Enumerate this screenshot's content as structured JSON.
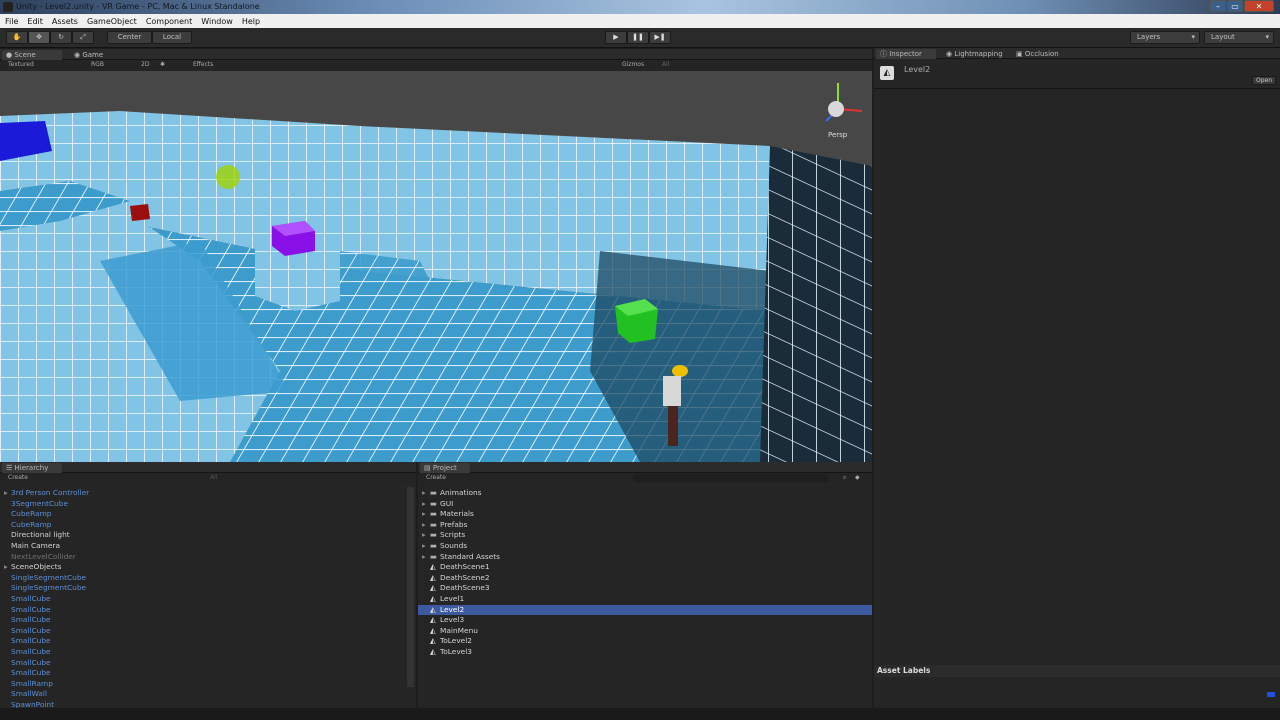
{
  "window": {
    "title": "Unity - Level2.unity - VR Game - PC, Mac & Linux Standalone"
  },
  "menu": [
    "File",
    "Edit",
    "Assets",
    "GameObject",
    "Component",
    "Window",
    "Help"
  ],
  "toolbar": {
    "pivot": "Center",
    "space": "Local",
    "layers": "Layers",
    "layout": "Layout"
  },
  "scene": {
    "tab_scene": "Scene",
    "tab_game": "Game",
    "shading": "Textured",
    "render": "RGB",
    "mode2d": "2D",
    "effects": "Effects",
    "gizmos": "Gizmos",
    "search": "All",
    "persp": "Persp"
  },
  "hierarchy": {
    "title": "Hierarchy",
    "create": "Create",
    "search": "All",
    "items": [
      {
        "label": "3rd Person Controller",
        "color": "blue",
        "fold": true
      },
      {
        "label": "3SegmentCube",
        "color": "blue",
        "fold": false
      },
      {
        "label": "CubeRamp",
        "color": "blue",
        "fold": false
      },
      {
        "label": "CubeRamp",
        "color": "blue",
        "fold": false
      },
      {
        "label": "Directional light",
        "color": "white",
        "fold": false
      },
      {
        "label": "Main Camera",
        "color": "white",
        "fold": false
      },
      {
        "label": "NextLevelCollider",
        "color": "gray",
        "fold": false
      },
      {
        "label": "SceneObjects",
        "color": "white",
        "fold": true
      },
      {
        "label": "SingleSegmentCube",
        "color": "blue",
        "fold": false
      },
      {
        "label": "SingleSegmentCube",
        "color": "blue",
        "fold": false
      },
      {
        "label": "SmallCube",
        "color": "blue",
        "fold": false
      },
      {
        "label": "SmallCube",
        "color": "blue",
        "fold": false
      },
      {
        "label": "SmallCube",
        "color": "blue",
        "fold": false
      },
      {
        "label": "SmallCube",
        "color": "blue",
        "fold": false
      },
      {
        "label": "SmallCube",
        "color": "blue",
        "fold": false
      },
      {
        "label": "SmallCube",
        "color": "blue",
        "fold": false
      },
      {
        "label": "SmallCube",
        "color": "blue",
        "fold": false
      },
      {
        "label": "SmallCube",
        "color": "blue",
        "fold": false
      },
      {
        "label": "SmallRamp",
        "color": "blue",
        "fold": false
      },
      {
        "label": "SmallWall",
        "color": "blue",
        "fold": false
      },
      {
        "label": "SpawnPoint",
        "color": "blue",
        "fold": false
      }
    ]
  },
  "project": {
    "title": "Project",
    "create": "Create",
    "items": [
      {
        "label": "Animations",
        "type": "folder"
      },
      {
        "label": "GUI",
        "type": "folder"
      },
      {
        "label": "Materials",
        "type": "folder"
      },
      {
        "label": "Prefabs",
        "type": "folder"
      },
      {
        "label": "Scripts",
        "type": "folder"
      },
      {
        "label": "Sounds",
        "type": "folder"
      },
      {
        "label": "Standard Assets",
        "type": "folder"
      },
      {
        "label": "DeathScene1",
        "type": "scene"
      },
      {
        "label": "DeathScene2",
        "type": "scene"
      },
      {
        "label": "DeathScene3",
        "type": "scene"
      },
      {
        "label": "Level1",
        "type": "scene"
      },
      {
        "label": "Level2",
        "type": "scene",
        "selected": true
      },
      {
        "label": "Level3",
        "type": "scene"
      },
      {
        "label": "MainMenu",
        "type": "scene"
      },
      {
        "label": "ToLevel2",
        "type": "scene"
      },
      {
        "label": "ToLevel3",
        "type": "scene"
      }
    ]
  },
  "inspector": {
    "tab_inspector": "Inspector",
    "tab_lightmapping": "Lightmapping",
    "tab_occlusion": "Occlusion",
    "object": "Level2",
    "open": "Open",
    "asset_labels": "Asset Labels"
  },
  "colors": {
    "selection": "#3d5aa0",
    "floor": "#3d9ccc",
    "wall": "#7fc0e4",
    "grid": "#ffffff"
  }
}
